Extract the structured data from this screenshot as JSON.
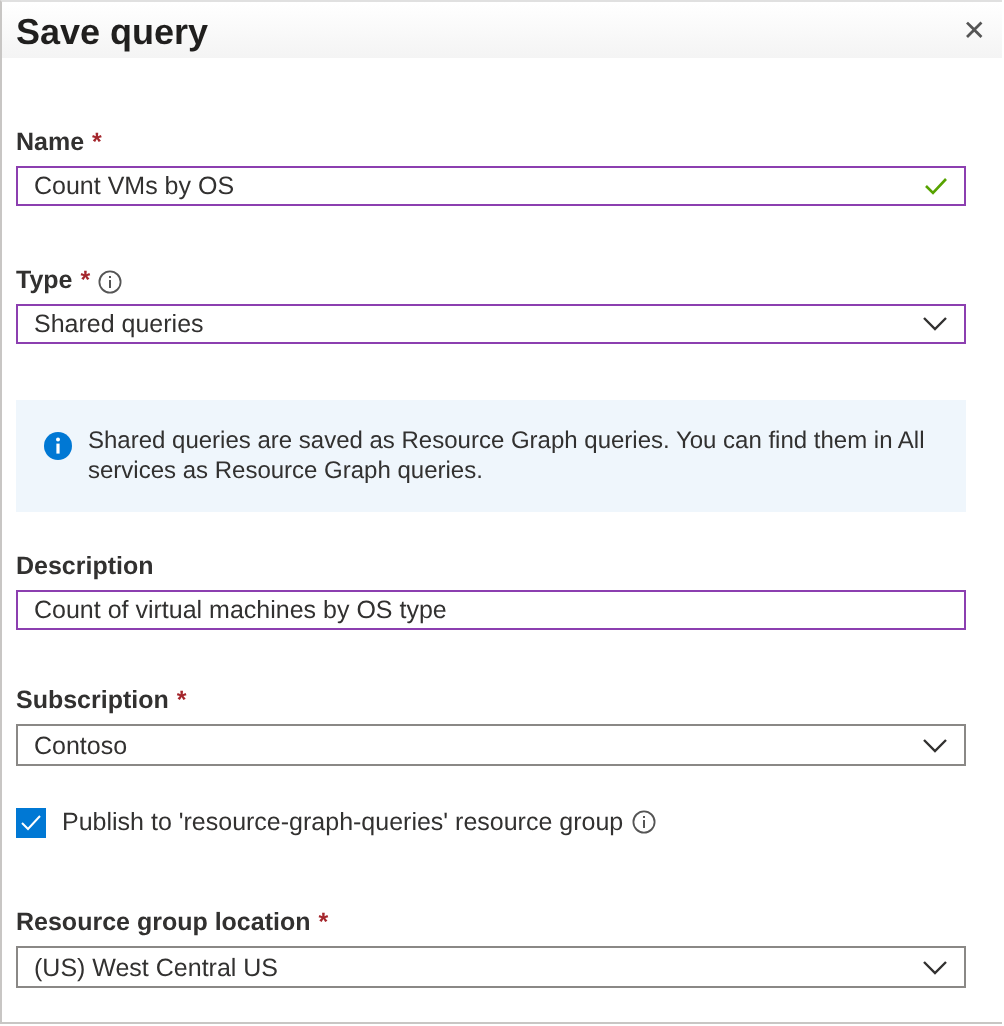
{
  "panel": {
    "title": "Save query",
    "close": "✕"
  },
  "fields": [
    {
      "kind": "text",
      "label": "Name",
      "required_mark": "*",
      "value": "Count VMs by OS",
      "highlighted": true,
      "valid": true
    },
    {
      "kind": "dropdown",
      "label": "Type",
      "required_mark": "*",
      "info": true,
      "value": "Shared queries",
      "highlighted": true
    },
    {
      "kind": "notice",
      "text": "Shared queries are saved as Resource Graph queries. You can find them in All services as Resource Graph queries."
    },
    {
      "kind": "text",
      "label": "Description",
      "value": "Count of virtual machines by OS type",
      "highlighted": true
    },
    {
      "kind": "dropdown",
      "label": "Subscription",
      "required_mark": "*",
      "value": "Contoso",
      "highlighted": false
    },
    {
      "kind": "checkbox",
      "label": "Publish to 'resource-graph-queries' resource group",
      "checked": true,
      "info": true
    },
    {
      "kind": "dropdown",
      "label": "Resource group location",
      "required_mark": "*",
      "value": "(US) West Central US",
      "highlighted": false
    }
  ]
}
